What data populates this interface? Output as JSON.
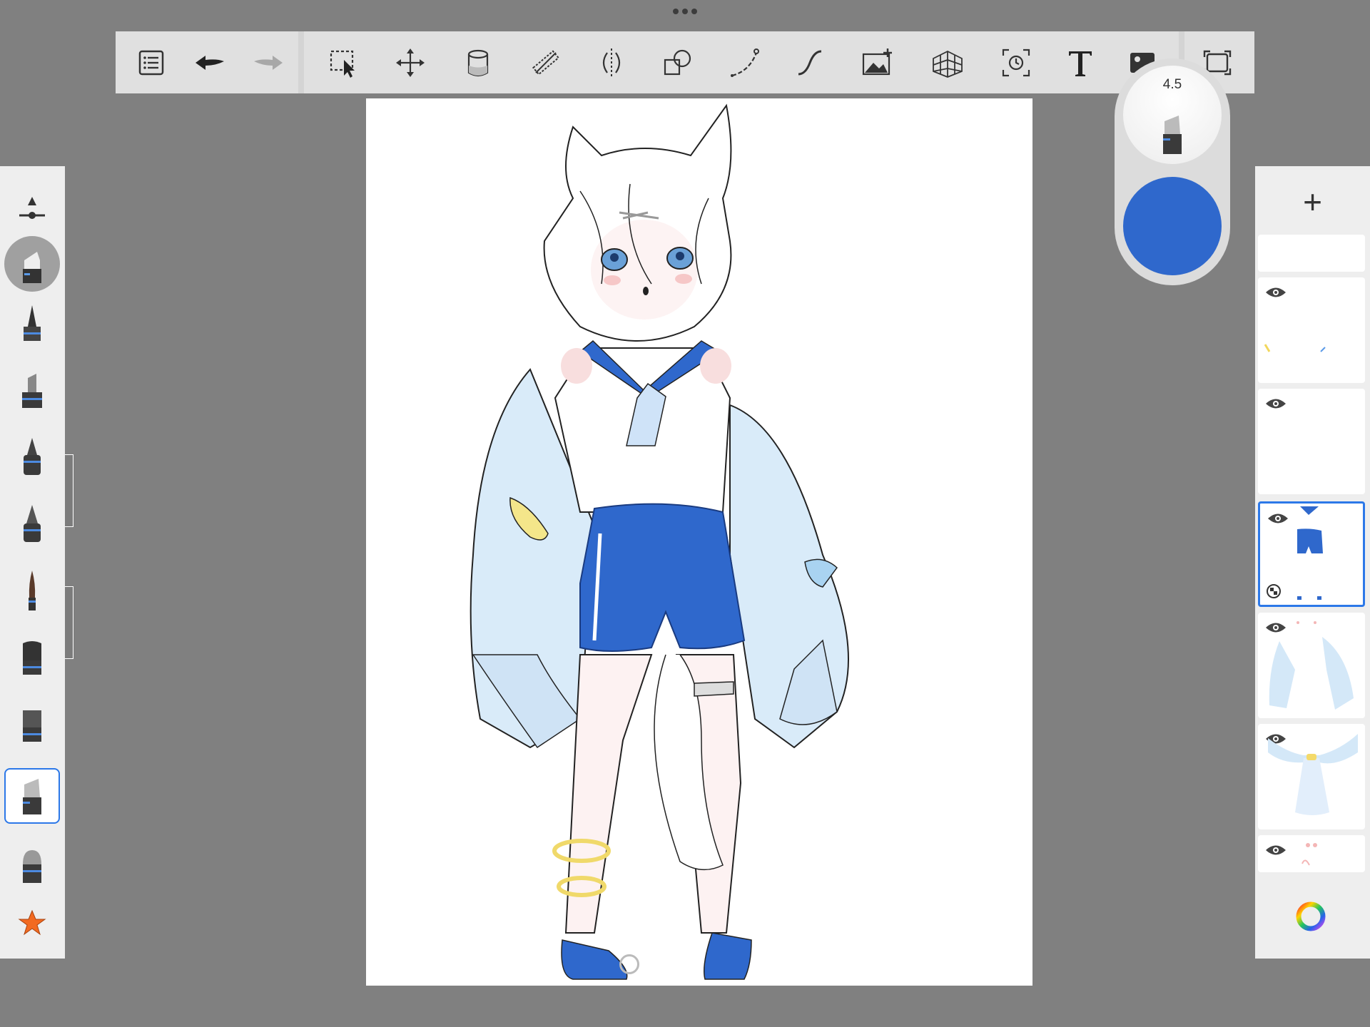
{
  "app": {
    "toolbar": {
      "buttons": [
        {
          "name": "menu-list",
          "icon": "list-icon"
        },
        {
          "name": "undo",
          "icon": "undo-arrow-icon"
        },
        {
          "name": "redo",
          "icon": "redo-arrow-icon"
        },
        {
          "name": "selection",
          "icon": "select-dashed-icon"
        },
        {
          "name": "transform",
          "icon": "move-arrows-icon"
        },
        {
          "name": "fill",
          "icon": "bucket-icon"
        },
        {
          "name": "ruler",
          "icon": "ruler-icon"
        },
        {
          "name": "symmetry",
          "icon": "symmetry-icon"
        },
        {
          "name": "shape",
          "icon": "shapes-icon"
        },
        {
          "name": "stroke",
          "icon": "curve-dots-icon"
        },
        {
          "name": "curve",
          "icon": "s-curve-icon"
        },
        {
          "name": "add-image",
          "icon": "image-plus-icon"
        },
        {
          "name": "perspective",
          "icon": "perspective-grid-icon"
        },
        {
          "name": "time-lapse",
          "icon": "timelapse-icon"
        },
        {
          "name": "text",
          "icon": "text-T-icon"
        },
        {
          "name": "reference",
          "icon": "image-icon"
        },
        {
          "name": "fullscreen",
          "icon": "fullscreen-icon"
        }
      ]
    },
    "brush_puck": {
      "size_value": "4.5",
      "color": "#2f68cc"
    },
    "brush_library": {
      "brushes": [
        {
          "name": "size-adjust",
          "icon": "size-slider-icon"
        },
        {
          "name": "marker-current",
          "icon": "marker-icon"
        },
        {
          "name": "pencil",
          "icon": "pencil-icon"
        },
        {
          "name": "marker",
          "icon": "marker-icon"
        },
        {
          "name": "pen",
          "icon": "pen-icon"
        },
        {
          "name": "ballpoint",
          "icon": "ballpoint-icon"
        },
        {
          "name": "paint-brush",
          "icon": "paint-brush-icon"
        },
        {
          "name": "flat-brush",
          "icon": "flat-brush-icon"
        },
        {
          "name": "wide-brush",
          "icon": "wide-brush-icon"
        },
        {
          "name": "chisel-marker",
          "icon": "chisel-marker-icon"
        },
        {
          "name": "eraser",
          "icon": "eraser-icon"
        },
        {
          "name": "favorites",
          "icon": "star-icon"
        }
      ],
      "selected_index": 9
    },
    "layers": {
      "add_label": "+",
      "items": [
        {
          "name": "layer-sparkles",
          "visible": true
        },
        {
          "name": "layer-empty",
          "visible": true
        },
        {
          "name": "layer-shorts",
          "visible": true,
          "selected": true
        },
        {
          "name": "layer-jacket",
          "visible": true
        },
        {
          "name": "layer-collar",
          "visible": true
        },
        {
          "name": "layer-blush",
          "visible": true
        }
      ],
      "color_wheel_icon": "color-wheel-icon"
    },
    "colors": {
      "accent": "#2c78e8",
      "paint_blue": "#2f68cc",
      "jacket_blue": "#d4e8f8"
    }
  }
}
